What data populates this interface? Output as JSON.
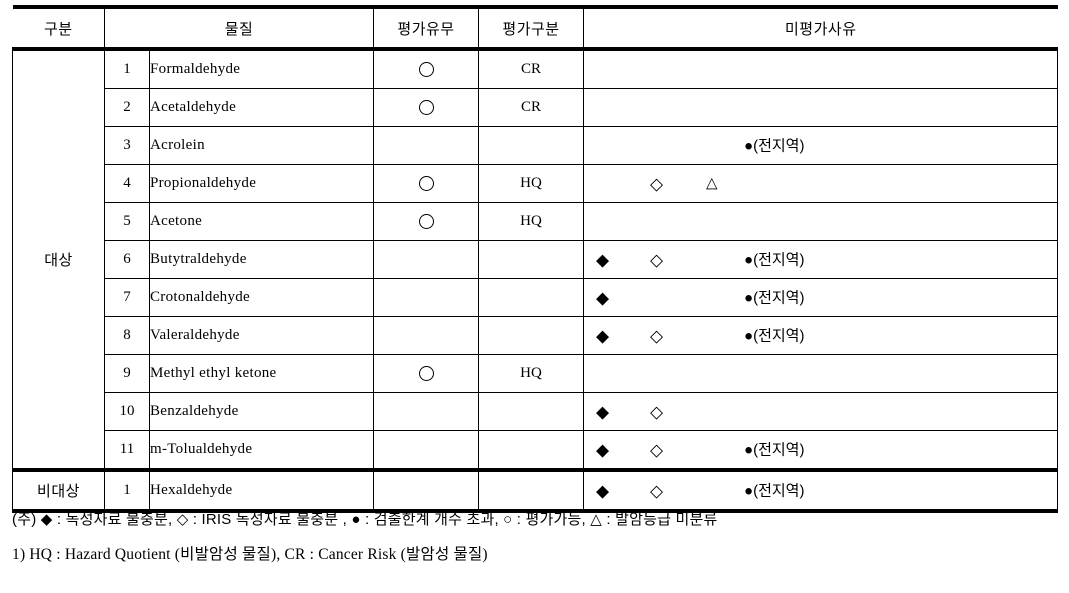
{
  "table": {
    "headers": {
      "group": "구분",
      "substance": "물질",
      "evaluated": "평가유무",
      "eval_type": "평가구분",
      "reason": "미평가사유"
    },
    "groups": [
      {
        "label": "대상",
        "row_span": 11
      },
      {
        "label": "비대상",
        "row_span": 1
      }
    ],
    "rows": [
      {
        "group": "대상",
        "no": "1",
        "name": "Formaldehyde",
        "evaluated": "○",
        "eval_type": "CR",
        "filled_diamond": "",
        "open_diamond": "",
        "triangle": "",
        "circle_note": ""
      },
      {
        "group": "대상",
        "no": "2",
        "name": "Acetaldehyde",
        "evaluated": "○",
        "eval_type": "CR",
        "filled_diamond": "",
        "open_diamond": "",
        "triangle": "",
        "circle_note": ""
      },
      {
        "group": "대상",
        "no": "3",
        "name": "Acrolein",
        "evaluated": "",
        "eval_type": "",
        "filled_diamond": "",
        "open_diamond": "",
        "triangle": "",
        "circle_note": "●(전지역)"
      },
      {
        "group": "대상",
        "no": "4",
        "name": "Propionaldehyde",
        "evaluated": "○",
        "eval_type": "HQ",
        "filled_diamond": "",
        "open_diamond": "◇",
        "triangle": "△",
        "circle_note": ""
      },
      {
        "group": "대상",
        "no": "5",
        "name": "Acetone",
        "evaluated": "○",
        "eval_type": "HQ",
        "filled_diamond": "",
        "open_diamond": "",
        "triangle": "",
        "circle_note": ""
      },
      {
        "group": "대상",
        "no": "6",
        "name": "Butytraldehyde",
        "evaluated": "",
        "eval_type": "",
        "filled_diamond": "◆",
        "open_diamond": "◇",
        "triangle": "",
        "circle_note": "●(전지역)"
      },
      {
        "group": "대상",
        "no": "7",
        "name": "Crotonaldehyde",
        "evaluated": "",
        "eval_type": "",
        "filled_diamond": "◆",
        "open_diamond": "",
        "triangle": "",
        "circle_note": "●(전지역)"
      },
      {
        "group": "대상",
        "no": "8",
        "name": "Valeraldehyde",
        "evaluated": "",
        "eval_type": "",
        "filled_diamond": "◆",
        "open_diamond": "◇",
        "triangle": "",
        "circle_note": "●(전지역)"
      },
      {
        "group": "대상",
        "no": "9",
        "name": "Methyl  ethyl  ketone",
        "evaluated": "○",
        "eval_type": "HQ",
        "filled_diamond": "",
        "open_diamond": "",
        "triangle": "",
        "circle_note": ""
      },
      {
        "group": "대상",
        "no": "10",
        "name": "Benzaldehyde",
        "evaluated": "",
        "eval_type": "",
        "filled_diamond": "◆",
        "open_diamond": "◇",
        "triangle": "",
        "circle_note": ""
      },
      {
        "group": "대상",
        "no": "11",
        "name": "m-Tolualdehyde",
        "evaluated": "",
        "eval_type": "",
        "filled_diamond": "◆",
        "open_diamond": "◇",
        "triangle": "",
        "circle_note": "●(전지역)"
      },
      {
        "group": "비대상",
        "no": "1",
        "name": "Hexaldehyde",
        "evaluated": "",
        "eval_type": "",
        "filled_diamond": "◆",
        "open_diamond": "◇",
        "triangle": "",
        "circle_note": "●(전지역)"
      }
    ]
  },
  "notes": {
    "line1": "(주) ◆ : 독성자료 불충분, ◇ : IRIS 독성자료 불충분 , ● : 검출한계 개수 초과, ○ :  평가가능, △ : 발암등급 미분류",
    "line2": "1) HQ : Hazard Quotient (비발암성 물질), CR : Cancer Risk (발암성 물질)"
  }
}
